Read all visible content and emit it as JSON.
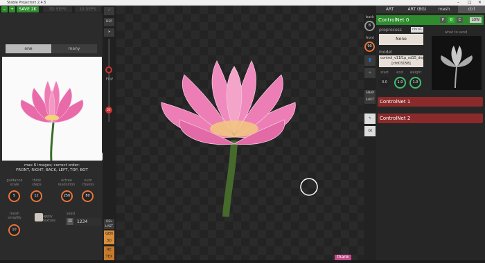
{
  "window": {
    "title": "Stable Projectorz 2.4.5"
  },
  "toolbar": {
    "minus": "–",
    "plus": "+",
    "save2k": "SAVE 2K",
    "save3d": "3D SEPS",
    "save_ui": "UI SEPS"
  },
  "left": {
    "tabs": [
      "one",
      "many"
    ],
    "hint_line1": "max 6 images;  correct order:",
    "hint_line2": "FRONT, RIGHT, BACK, LEFT, TOP, BOT",
    "badge_3d": "3D",
    "knobs": [
      {
        "label": "guidance scale",
        "value": "5"
      },
      {
        "label": "think steps",
        "value": "12"
      },
      {
        "label": "octree resolution",
        "value": "256"
      },
      {
        "label": "num chunks",
        "value": "80"
      }
    ],
    "mesh_simplify": {
      "label": "mesh simplify",
      "value": "10"
    },
    "apply_texture": "apply texture",
    "seed_label": "seed",
    "seed_value": "1234"
  },
  "vstrip": {
    "dep": "DEP",
    "fov": "FOV",
    "fov_value": "22",
    "del_last": "DEL LAST",
    "gen3d": "GEN 3D",
    "retex": "RE TEX"
  },
  "rstrip": {
    "back": "back",
    "back_value": "8",
    "front": "front",
    "front_value": "90",
    "snapshot": "SNAP SHOT"
  },
  "right": {
    "tabs": [
      "ART",
      "ART (BG)",
      "mesh",
      "ctrl"
    ],
    "controlnet0": {
      "title": "ControlNet 0",
      "p": "P",
      "b": "B",
      "c": "C",
      "low": "LOW"
    },
    "preprocess_label": "preprocess",
    "res_label": "res x1",
    "preprocess_value": "None",
    "what_to_send": "what to send",
    "model_label": "model",
    "model_value": "control_v11f1p_sd15_depth [cfd03158]",
    "start_label": "start",
    "start_value": "0.0",
    "end_label": "end",
    "end_value": "1.0",
    "weight_label": "weight",
    "weight_value": "1.0",
    "controlnet1": "ControlNet 1",
    "controlnet2": "ControlNet 2"
  },
  "footer": {
    "thank": "thank"
  }
}
